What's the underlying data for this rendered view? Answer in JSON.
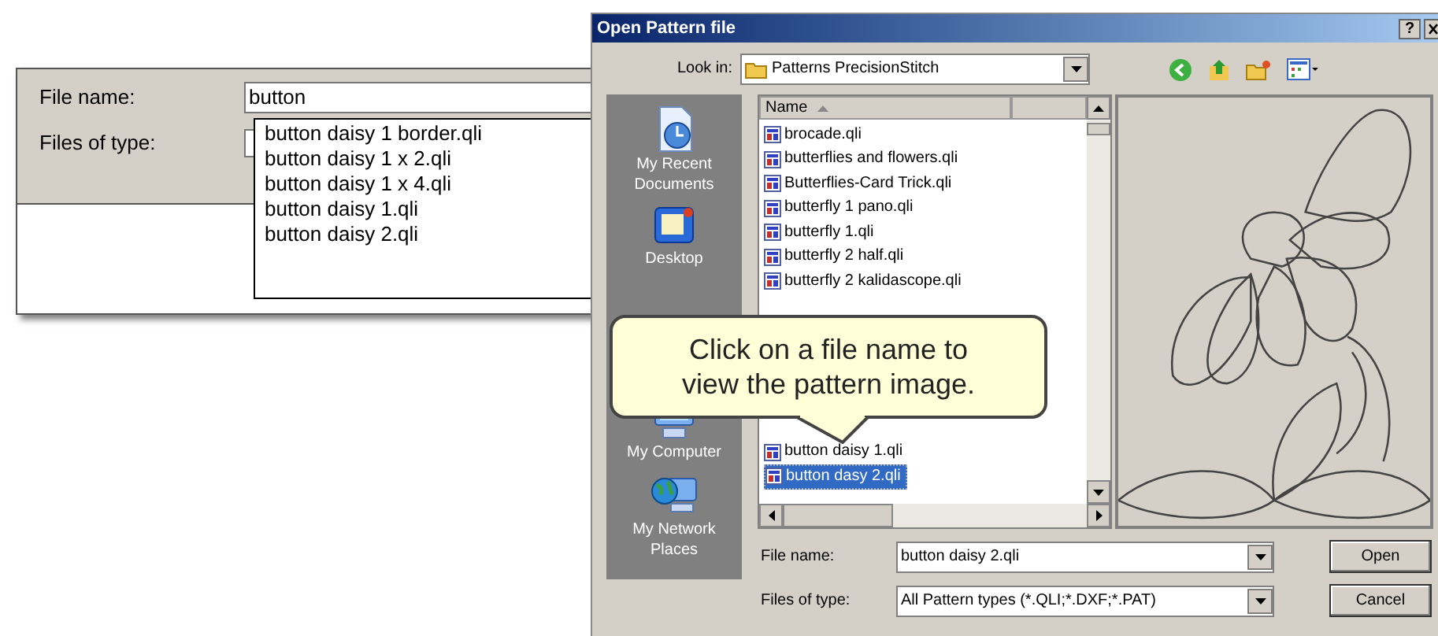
{
  "autocomplete_panel": {
    "file_name_label": "File name:",
    "file_name_value": "button",
    "files_of_type_label": "Files of type:",
    "suggestions": [
      "button daisy 1 border.qli",
      "button daisy 1 x 2.qli",
      "button daisy 1 x 4.qli",
      "button daisy 1.qli",
      "button daisy 2.qli"
    ]
  },
  "dialog": {
    "title": "Open Pattern file",
    "help_button": "?",
    "look_in_label": "Look in:",
    "look_in_value": "Patterns PrecisionStitch",
    "places": [
      {
        "label": "My Recent Documents"
      },
      {
        "label": "Desktop"
      },
      {
        "label": "My Computer"
      },
      {
        "label": "My Network Places"
      }
    ],
    "file_list": {
      "column": "Name",
      "files": [
        {
          "name": "brocade.qli",
          "selected": false
        },
        {
          "name": "butterflies and flowers.qli",
          "selected": false
        },
        {
          "name": "Butterflies-Card Trick.qli",
          "selected": false
        },
        {
          "name": "butterfly 1 pano.qli",
          "selected": false
        },
        {
          "name": "butterfly 1.qli",
          "selected": false
        },
        {
          "name": "butterfly 2 half.qli",
          "selected": false
        },
        {
          "name": "butterfly 2 kalidascope.qli",
          "selected": false
        },
        {
          "name": "button daisy 1.qli",
          "selected": false
        },
        {
          "name": "button dasy 2.qli",
          "selected": true
        }
      ]
    },
    "file_name_label": "File name:",
    "file_name_value": "button daisy 2.qli",
    "files_of_type_label": "Files of type:",
    "files_of_type_value": "All Pattern types (*.QLI;*.DXF;*.PAT)",
    "buttons": [
      "Open",
      "Cancel"
    ]
  },
  "callout": {
    "text": "Click on a file name to view the pattern image."
  }
}
